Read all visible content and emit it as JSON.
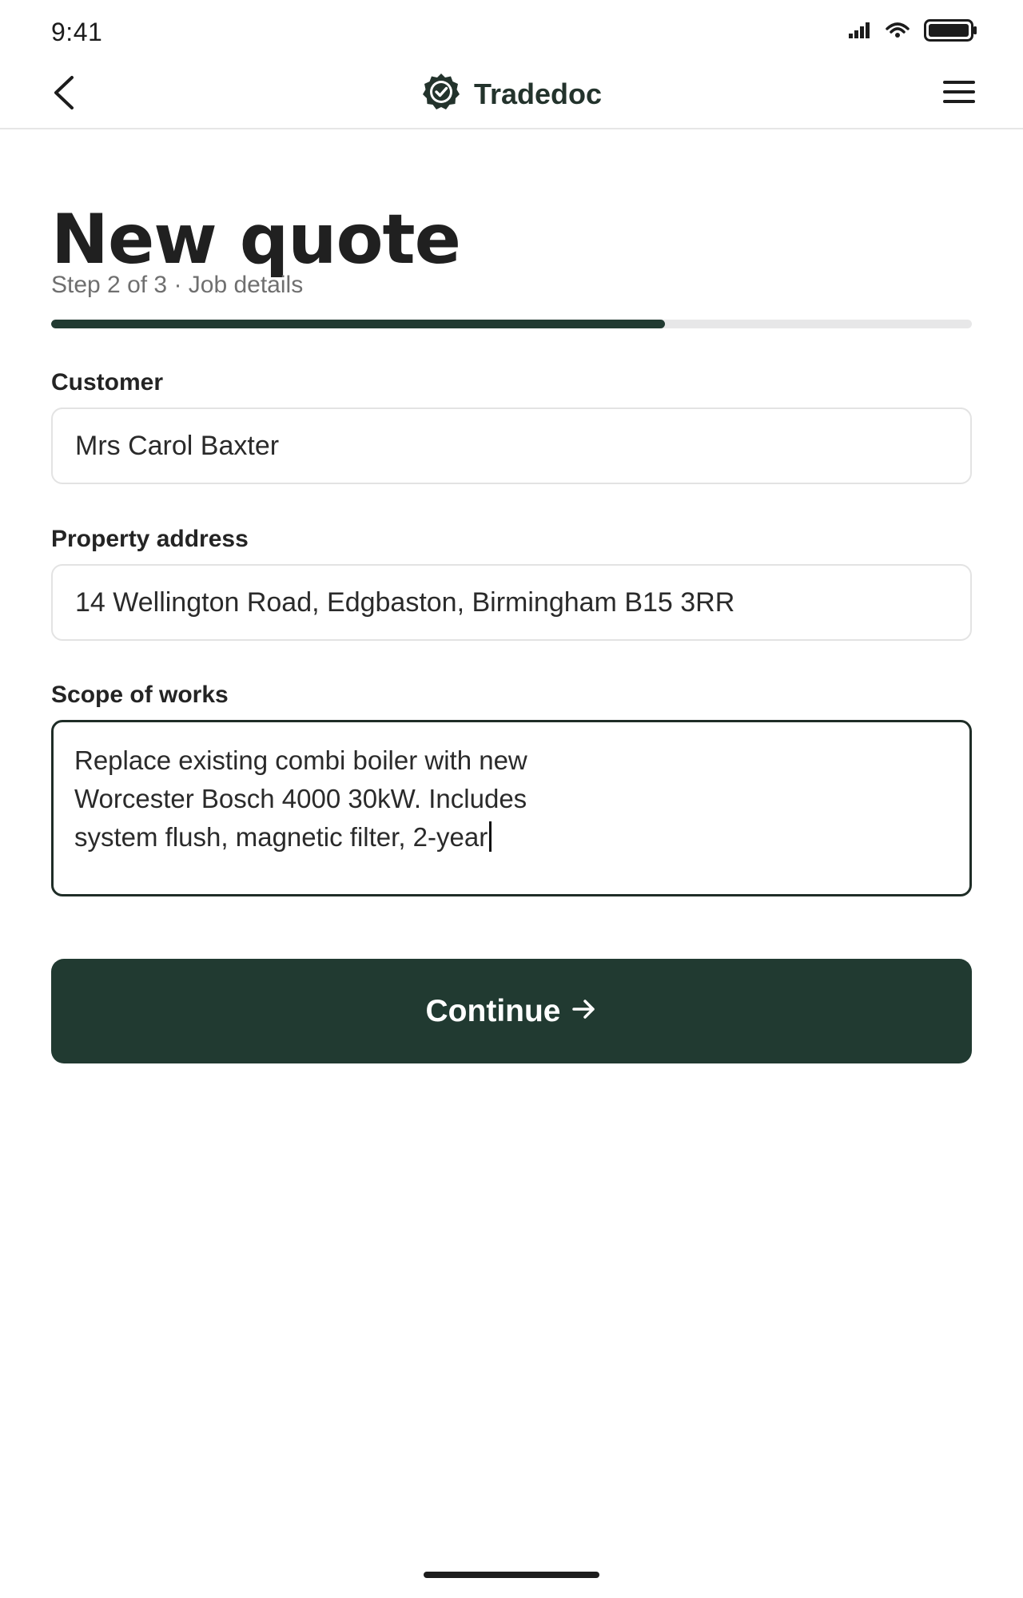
{
  "status_bar": {
    "time": "9:41",
    "icons": [
      "signal-icon",
      "wifi-icon",
      "battery-icon"
    ]
  },
  "header": {
    "brand_name": "Tradedoc",
    "icons": [
      "back-arrow-icon",
      "badge-check-icon",
      "hamburger-menu-icon"
    ]
  },
  "page": {
    "title": "New quote",
    "step_text": "Step 2 of 3 · Job details",
    "progress_fraction": 0.667
  },
  "form": {
    "customer_label": "Customer",
    "customer_value": "Mrs Carol Baxter",
    "address_label": "Property address",
    "address_value": "14 Wellington Road, Edgbaston, Birmingham B15 3RR",
    "scope_label": "Scope of works",
    "scope_value_lines": [
      "Replace existing combi boiler with new",
      "Worcester Bosch 4000 30kW. Includes",
      "system flush, magnetic filter, 2-year"
    ]
  },
  "actions": {
    "continue_label": "Continue",
    "continue_icon": "arrow-right-icon"
  },
  "colors": {
    "brand_dark_green": "#213a31",
    "progress_track": "#e7e7e8",
    "muted_text": "#6f6f6f"
  }
}
